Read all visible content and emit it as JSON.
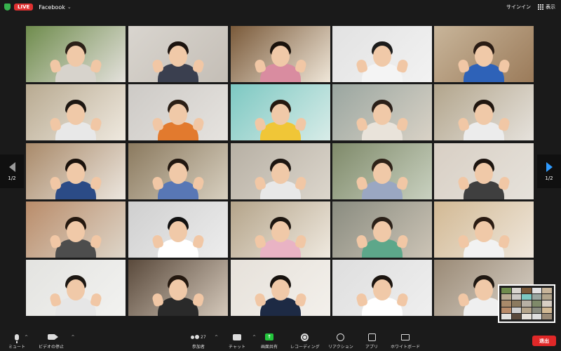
{
  "topbar": {
    "live_label": "LIVE",
    "stream_target": "Facebook",
    "sign_in": "サインイン",
    "view_label": "表示"
  },
  "pager": {
    "current_left": "1/2",
    "current_right": "1/2"
  },
  "colors": {
    "active_border": "#52d05a",
    "live_red": "#e03131",
    "share_green": "#23c53c",
    "leave_red": "#e02828",
    "next_arrow": "#2f9bff"
  },
  "tiles": [
    {
      "bg": "#6f8c4d",
      "bg2": "#e4e1dc",
      "shirt": "#d7d3cc",
      "hair": "#2b2018",
      "wave": true
    },
    {
      "bg": "#d9d5cf",
      "bg2": "#c4beb6",
      "shirt": "#3a3f4f",
      "hair": "#1c1410",
      "wave": true,
      "active": true
    },
    {
      "bg": "#7a5a3a",
      "bg2": "#efe6d8",
      "shirt": "#d98ca0",
      "hair": "#1a120c",
      "wave": true
    },
    {
      "bg": "#e2e2e2",
      "bg2": "#f2f2f2",
      "shirt": "#f4f4f4",
      "hair": "#1b1b1b",
      "wave": true
    },
    {
      "bg": "#c8b59a",
      "bg2": "#9b7b5a",
      "shirt": "#2e62b8",
      "hair": "#2a1c14",
      "wave": true
    },
    {
      "bg": "#b8aa91",
      "bg2": "#efe9df",
      "shirt": "#e8e8e8",
      "hair": "#1d1712",
      "wave": true
    },
    {
      "bg": "#cdcac6",
      "bg2": "#e6e3df",
      "shirt": "#e27a2e",
      "hair": "#2b1f16",
      "wave": true
    },
    {
      "bg": "#7dc8c2",
      "bg2": "#d8ece8",
      "shirt": "#f0c637",
      "hair": "#24180f",
      "wave": true
    },
    {
      "bg": "#9aa6a0",
      "bg2": "#d9d2c6",
      "shirt": "#e9e3da",
      "hair": "#2a1f18",
      "wave": true
    },
    {
      "bg": "#b2a58c",
      "bg2": "#e6e2dc",
      "shirt": "#ececec",
      "hair": "#20160f",
      "wave": true
    },
    {
      "bg": "#a98a6a",
      "bg2": "#ece6de",
      "shirt": "#2b4b86",
      "hair": "#1a120c",
      "wave": true
    },
    {
      "bg": "#8b7a5f",
      "bg2": "#d7cfbf",
      "shirt": "#5877b5",
      "hair": "#211710",
      "wave": true
    },
    {
      "bg": "#b7b0a4",
      "bg2": "#dcd6cc",
      "shirt": "#e8e8e8",
      "hair": "#1c1510",
      "wave": true
    },
    {
      "bg": "#7f8a6a",
      "bg2": "#c9d1c0",
      "shirt": "#9aa7c2",
      "hair": "#2e2218",
      "wave": true
    },
    {
      "bg": "#d8cfc4",
      "bg2": "#e6e2db",
      "shirt": "#3f3f3f",
      "hair": "#1c140f",
      "wave": true
    },
    {
      "bg": "#b98c6a",
      "bg2": "#ded6c9",
      "shirt": "#4d4d4d",
      "hair": "#24180f",
      "wave": true
    },
    {
      "bg": "#cfcfcf",
      "bg2": "#ededed",
      "shirt": "#ffffff",
      "hair": "#111111",
      "wave": true
    },
    {
      "bg": "#b4a48a",
      "bg2": "#efe9df",
      "shirt": "#e9b3c4",
      "hair": "#1d1610",
      "wave": true
    },
    {
      "bg": "#8a8c80",
      "bg2": "#ccc4b6",
      "shirt": "#5da78a",
      "hair": "#2a2018",
      "wave": true
    },
    {
      "bg": "#d2b994",
      "bg2": "#efe7dc",
      "shirt": "#f2f2f2",
      "hair": "#2a1b12",
      "wave": true
    },
    {
      "bg": "#e3e3e0",
      "bg2": "#f2f2f0",
      "shirt": "#e6e6e6",
      "hair": "#1c1712",
      "wave": true
    },
    {
      "bg": "#5a4a3c",
      "bg2": "#d4c8ba",
      "shirt": "#2a2a2a",
      "hair": "#24180f",
      "wave": true
    },
    {
      "bg": "#e6e1da",
      "bg2": "#f3f0eb",
      "shirt": "#1d2a44",
      "hair": "#17120e",
      "wave": true
    },
    {
      "bg": "#dedede",
      "bg2": "#efefef",
      "shirt": "#ffffff",
      "hair": "#1c1510",
      "wave": true
    },
    {
      "bg": "#9a8a76",
      "bg2": "#d9d2c8",
      "shirt": "#efefef",
      "hair": "#1f1812",
      "wave": true
    }
  ],
  "toolbar": {
    "mute": "ミュート",
    "stop_video": "ビデオの停止",
    "participants": "参加者",
    "participants_count": "27",
    "chat": "チャット",
    "share_screen": "画面共有",
    "recording": "レコーディング",
    "reactions": "リアクション",
    "apps": "アプリ",
    "whiteboard": "ホワイトボード",
    "leave": "退出"
  }
}
